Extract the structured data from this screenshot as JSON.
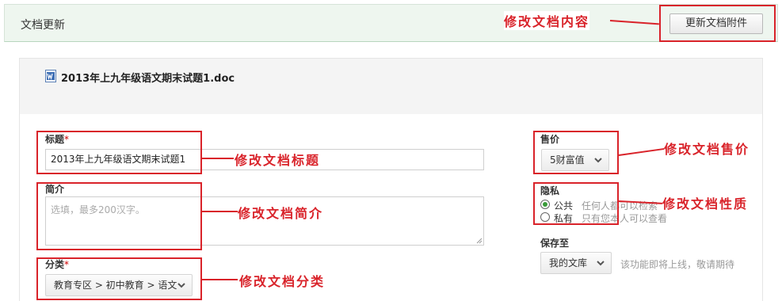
{
  "header": {
    "title": "文档更新",
    "update_attachment_button": "更新文档附件"
  },
  "file": {
    "icon": "word-doc-icon",
    "name": "2013年上九年级语文期末试题1.doc"
  },
  "form": {
    "title_label": "标题",
    "title_value": "2013年上九年级语文期末试题1",
    "intro_label": "简介",
    "intro_placeholder": "选填，最多200汉字。",
    "category_label": "分类",
    "category_value": "教育专区 > 初中教育 > 语文",
    "required_mark": "*"
  },
  "sidebar": {
    "price_label": "售价",
    "price_value": "5财富值",
    "privacy_label": "隐私",
    "privacy_options": [
      {
        "label": "公共",
        "desc": "任何人都可以检索",
        "selected": true
      },
      {
        "label": "私有",
        "desc": "只有您本人可以查看",
        "selected": false
      }
    ],
    "save_to_label": "保存至",
    "save_to_value": "我的文库",
    "save_to_note": "该功能即将上线，敬请期待"
  },
  "annotations": {
    "edit_content": "修改文档内容",
    "edit_title": "修改文档标题",
    "edit_intro": "修改文档简介",
    "edit_category": "修改文档分类",
    "edit_price": "修改文档售价",
    "edit_privacy": "修改文档性质"
  },
  "colors": {
    "annotation_red": "#d9232a",
    "header_bg": "#eef6ef",
    "radio_green": "#3a9b3a"
  }
}
